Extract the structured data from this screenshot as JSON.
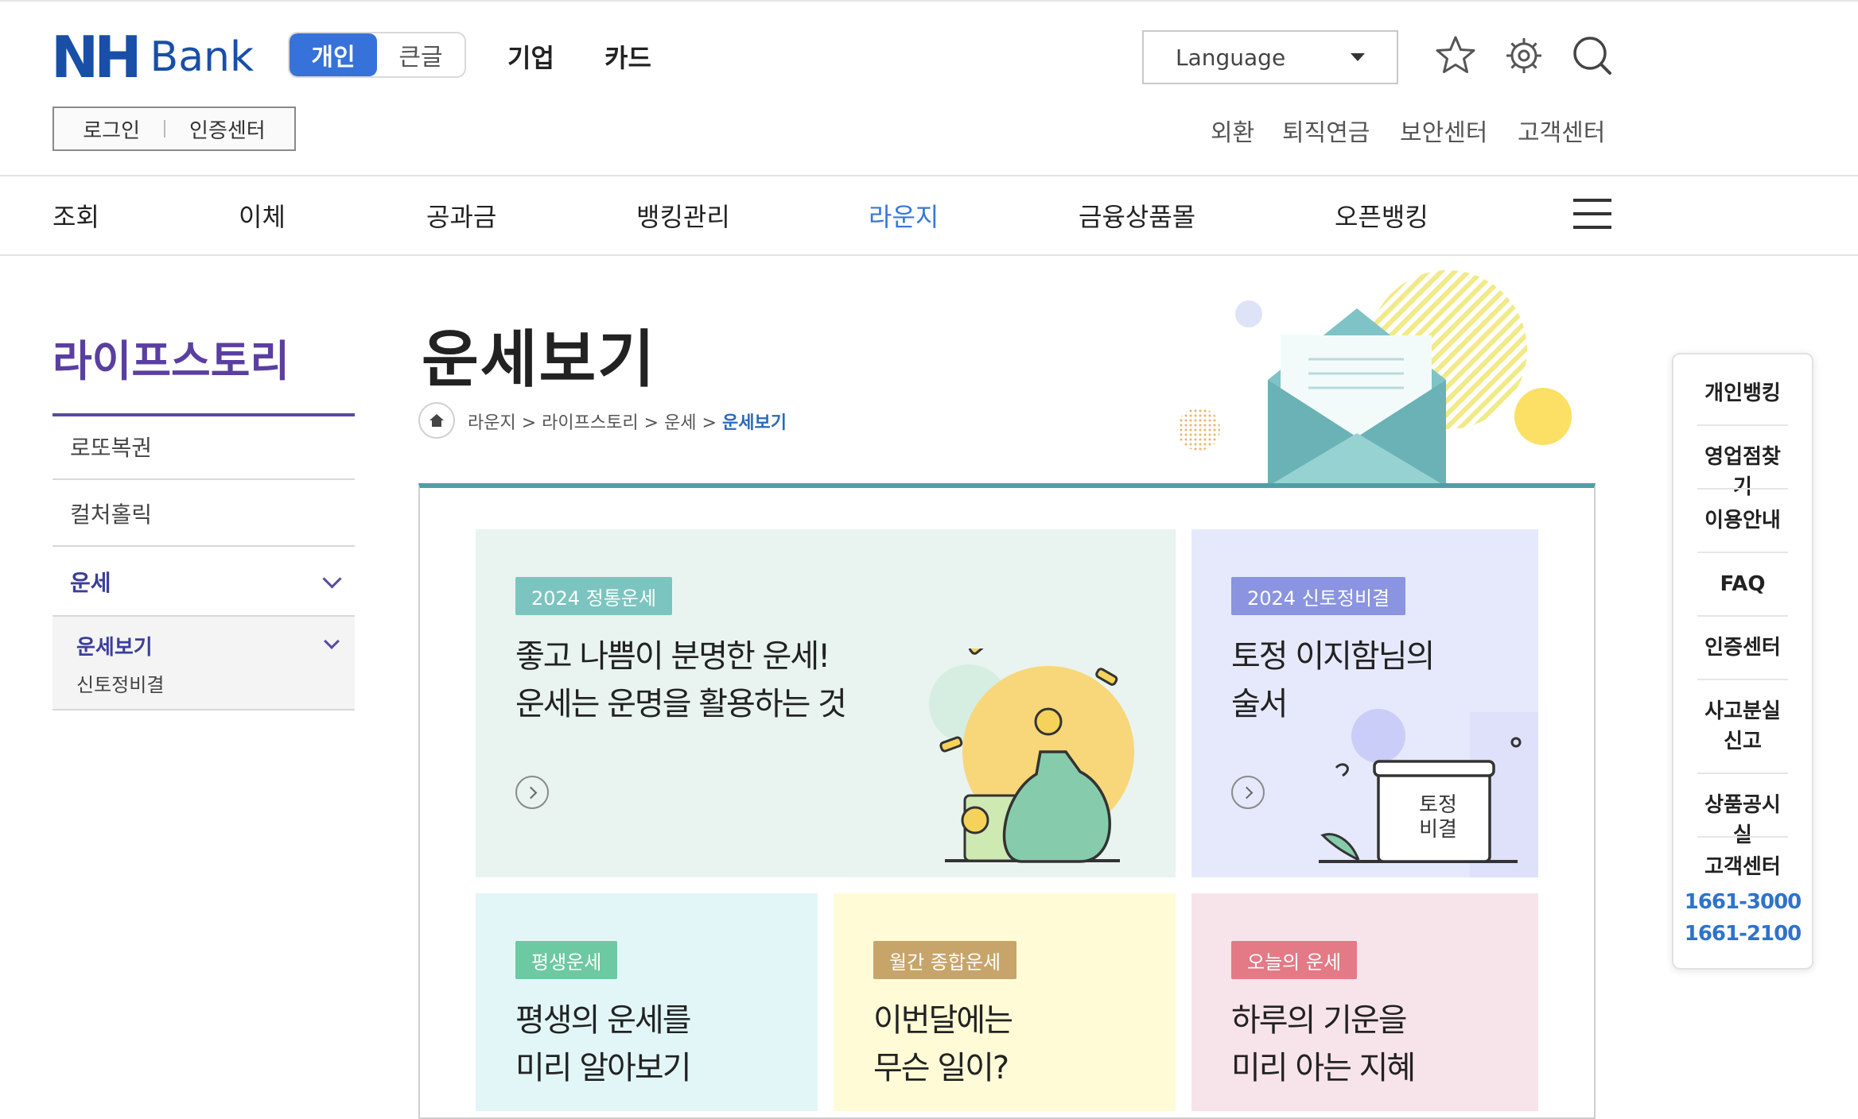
{
  "brand": {
    "logo_nh": "NH",
    "logo_bank": "Bank",
    "color": "#1a4fa8"
  },
  "mode_toggle": {
    "personal": "개인",
    "large": "큰글"
  },
  "top_links": {
    "corporate": "기업",
    "card": "카드"
  },
  "language": {
    "label": "Language"
  },
  "auth": {
    "login": "로그인",
    "cert": "인증센터"
  },
  "util_links": [
    "외환",
    "퇴직연금",
    "보안센터",
    "고객센터"
  ],
  "main_nav": [
    "조회",
    "이체",
    "공과금",
    "뱅킹관리",
    "라운지",
    "금융상품몰",
    "오픈뱅킹"
  ],
  "main_nav_active": "라운지",
  "sidebar": {
    "title": "라이프스토리",
    "items": [
      "로또복권",
      "컬처홀릭",
      "운세"
    ],
    "sub_items": [
      "운세보기",
      "신토정비결"
    ]
  },
  "page": {
    "title": "운세보기",
    "breadcrumb": [
      "라운지",
      "라이프스토리",
      "운세"
    ],
    "breadcrumb_current": "운세보기",
    "breadcrumb_sep": ">"
  },
  "cards": [
    {
      "badge": "2024 정통운세",
      "line1": "좋고 나쁨이 분명한 운세!",
      "line2": "운세는 운명을 활용하는 것",
      "bg": "#e9f3f0",
      "badge_color": "#7cc4bf"
    },
    {
      "badge": "2024 신토정비결",
      "line1": "토정 이지함님의",
      "line2": "술서",
      "bg": "#e6e9fb",
      "badge_color": "#8a94e0",
      "book_text1": "토정",
      "book_text2": "비결"
    },
    {
      "badge": "평생운세",
      "line1": "평생의 운세를",
      "line2": "미리 알아보기",
      "bg": "#e2f6f8",
      "badge_color": "#6cc9a2"
    },
    {
      "badge": "월간 종합운세",
      "line1": "이번달에는",
      "line2": "무슨 일이?",
      "bg": "#fffbd6",
      "badge_color": "#c7a56a"
    },
    {
      "badge": "오늘의 운세",
      "line1": "하루의 기운을",
      "line2": "미리 아는 지혜",
      "bg": "#f7e4ea",
      "badge_color": "#e37a86"
    }
  ],
  "quick_menu": {
    "items": [
      "개인뱅킹",
      "영업점찾기",
      "이용안내",
      "FAQ",
      "인증센터",
      "사고분실 신고",
      "상품공시실",
      "고객센터"
    ],
    "phones": [
      "1661-3000",
      "1661-2100"
    ]
  },
  "icons": {
    "favorite": "star-icon",
    "settings": "gear-icon",
    "search": "search-icon",
    "home": "home-icon",
    "menu": "hamburger-icon"
  }
}
